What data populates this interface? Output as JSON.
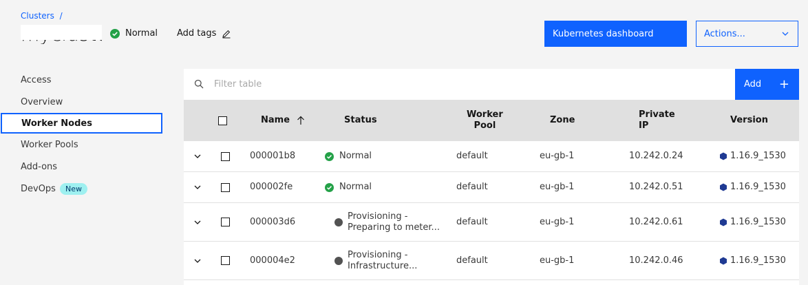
{
  "breadcrumb": {
    "root": "Clusters",
    "separator": "/"
  },
  "cluster": {
    "title": "mycluster",
    "health": "Normal",
    "add_tags": "Add tags"
  },
  "header": {
    "dashboard_button": "Kubernetes dashboard",
    "actions_select": "Actions..."
  },
  "sidebar": {
    "items": [
      {
        "label": "Access"
      },
      {
        "label": "Overview"
      },
      {
        "label": "Worker Nodes",
        "active": true
      },
      {
        "label": "Worker Pools"
      },
      {
        "label": "Add-ons"
      },
      {
        "label": "DevOps",
        "badge": "New"
      }
    ]
  },
  "table": {
    "filter_placeholder": "Filter table",
    "add_button": "Add",
    "columns": {
      "name": "Name",
      "status": "Status",
      "worker_pool_1": "Worker",
      "worker_pool_2": "Pool",
      "zone": "Zone",
      "private_ip_1": "Private",
      "private_ip_2": "IP",
      "version": "Version"
    },
    "rows": [
      {
        "name": "000001b8",
        "status": "Normal",
        "status_line2": "",
        "pool": "default",
        "zone": "eu-gb-1",
        "ip": "10.242.0.24",
        "version": "1.16.9_1530",
        "state": "ok"
      },
      {
        "name": "000002fe",
        "status": "Normal",
        "status_line2": "",
        "pool": "default",
        "zone": "eu-gb-1",
        "ip": "10.242.0.51",
        "version": "1.16.9_1530",
        "state": "ok"
      },
      {
        "name": "000003d6",
        "status": "Provisioning -",
        "status_line2": "Preparing to meter...",
        "pool": "default",
        "zone": "eu-gb-1",
        "ip": "10.242.0.61",
        "version": "1.16.9_1530",
        "state": "provisioning"
      },
      {
        "name": "000004e2",
        "status": "Provisioning -",
        "status_line2": "Infrastructure...",
        "pool": "default",
        "zone": "eu-gb-1",
        "ip": "10.242.0.46",
        "version": "1.16.9_1530",
        "state": "provisioning"
      }
    ]
  },
  "colors": {
    "accent": "#0f62fe",
    "success": "#24a148",
    "badge": "#9ef0f0",
    "kube": "#1f3a93"
  }
}
